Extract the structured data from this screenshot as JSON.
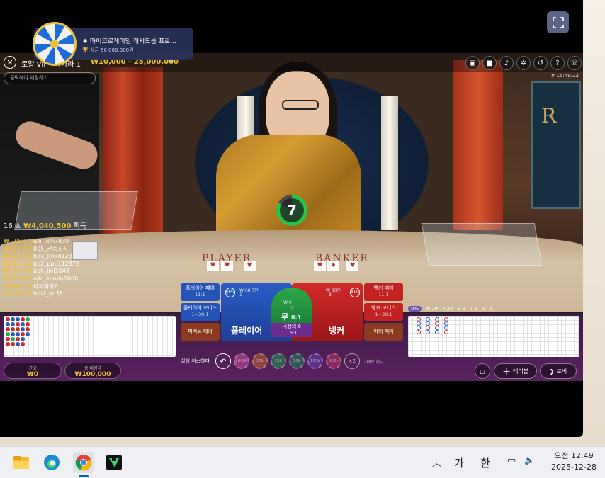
{
  "promo": {
    "title": "♠ 마이크로게이밍 캐시드롭 프로...",
    "subtitle": "🏆 상금 50,000,000원"
  },
  "game": {
    "title": "로얄 VIP",
    "title_suffix": "바카라 1",
    "limits": "₩10,000 - 25,000,000",
    "time": "# 15:49:22",
    "chat_placeholder": "클릭하여 채팅하기",
    "timer": "7",
    "table_player_text": "PLAYER",
    "table_banker_text": "BANKER",
    "logo_text": "ROYAL RE"
  },
  "winners": {
    "count": "16",
    "total": "₩4,040,500",
    "suffix": "획득",
    "list": [
      {
        "amount": "₩1,050,000",
        "name": "ulli_sdh7839"
      },
      {
        "amount": "₩877,500",
        "name": "805_권승스식"
      },
      {
        "amount": "₩615,000",
        "name": "bpy_tmkd123"
      },
      {
        "amount": "₩382,500",
        "name": "bp2_ppp112872"
      },
      {
        "amount": "₩195,000",
        "name": "bph_jjvl2848"
      },
      {
        "amount": "₩195,000",
        "name": "allc_lmmin0000"
      },
      {
        "amount": "₩146,250",
        "name": "아자아자?"
      },
      {
        "amount": "₩136,500",
        "name": "bm7_kd38"
      }
    ]
  },
  "bets": {
    "player_pair": "플레이어 페어",
    "player_pair_odds": "11:1",
    "player_bonus": "플레이어 보너스",
    "player_bonus_odds": "1~30:1",
    "perfect_pair": "퍼펙트 페어",
    "banker_pair": "뱅커 페어",
    "banker_pair_odds": "11:1",
    "banker_bonus": "뱅커 보너스",
    "banker_bonus_odds": "1~30:1",
    "either_pair": "이더 페어",
    "player": "플레이어",
    "banker": "뱅커",
    "tie": "무",
    "tie_odds": "8:1",
    "super6": "극상의 6",
    "super6_odds": "15:1",
    "player_pct": "69%",
    "banker_pct": "31%",
    "player_amount": "₩ 68,7만",
    "banker_amount": "₩ 30만",
    "tie_amount": "₩ 0",
    "player_count": "1",
    "banker_count": "8",
    "tie_count": "0"
  },
  "stats": {
    "shoe": "# 29",
    "player": "P 20",
    "banker": "B 8",
    "tie": "T 1",
    "pp": "2",
    "bp": "2",
    "pct_label": "0%"
  },
  "chips": {
    "label": "실행 취소하다",
    "values": [
      "2000k",
      "10k",
      "25k",
      "50k",
      "100k",
      "500k"
    ],
    "double": "×2",
    "double_label": "2배로 하다"
  },
  "wallet": {
    "balance_label": "잔고",
    "balance": "₩0",
    "total_bet_label": "총 배팅금",
    "total_bet": "₩100,000"
  },
  "buttons": {
    "table": "테이블",
    "lobby": "로비"
  },
  "taskbar": {
    "ime1": "가",
    "ime2": "한",
    "time": "오전 12:49",
    "date": "2025-12-28"
  },
  "colors": {
    "player": "#2a5cc4",
    "banker": "#d02a2a",
    "tie": "#2ca84a",
    "accent": "#f2c230"
  }
}
